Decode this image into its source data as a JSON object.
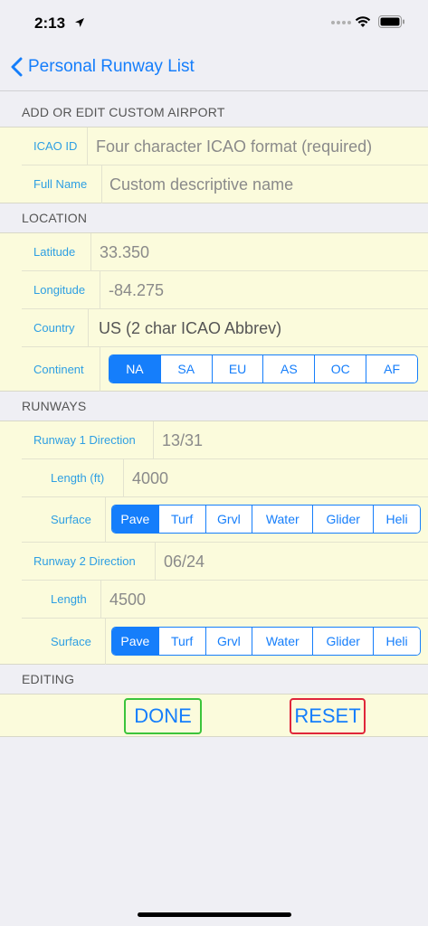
{
  "status": {
    "time": "2:13"
  },
  "nav": {
    "back_label": "Personal Runway List"
  },
  "sections": {
    "airport": "ADD OR EDIT CUSTOM AIRPORT",
    "location": "LOCATION",
    "runways": "RUNWAYS",
    "editing": "EDITING"
  },
  "airport": {
    "icao_label": "ICAO ID",
    "icao_placeholder": "Four character ICAO format (required)",
    "fullname_label": "Full Name",
    "fullname_placeholder": "Custom descriptive name"
  },
  "location": {
    "latitude_label": "Latitude",
    "latitude_value": "33.350",
    "longitude_label": "Longitude",
    "longitude_value": "-84.275",
    "country_label": "Country",
    "country_value": "US  (2 char ICAO Abbrev)",
    "continent_label": "Continent",
    "continents": [
      "NA",
      "SA",
      "EU",
      "AS",
      "OC",
      "AF"
    ],
    "continent_selected": "NA"
  },
  "runways": {
    "r1_direction_label": "Runway 1 Direction",
    "r1_direction_value": "13/31",
    "r1_length_label": "Length (ft)",
    "r1_length_value": "4000",
    "r1_surface_label": "Surface",
    "r2_direction_label": "Runway 2 Direction",
    "r2_direction_value": "06/24",
    "r2_length_label": "Length",
    "r2_length_value": "4500",
    "r2_surface_label": "Surface",
    "surfaces": [
      "Pave",
      "Turf",
      "Grvl",
      "Water",
      "Glider",
      "Heli"
    ],
    "r1_surface_selected": "Pave",
    "r2_surface_selected": "Pave"
  },
  "editing": {
    "done_label": "DONE",
    "reset_label": "RESET"
  },
  "colors": {
    "accent": "#157efb",
    "label": "#2e9fe3",
    "cell_bg": "#fbfbdc",
    "done_border": "#3bc43b",
    "reset_border": "#e0263a"
  }
}
